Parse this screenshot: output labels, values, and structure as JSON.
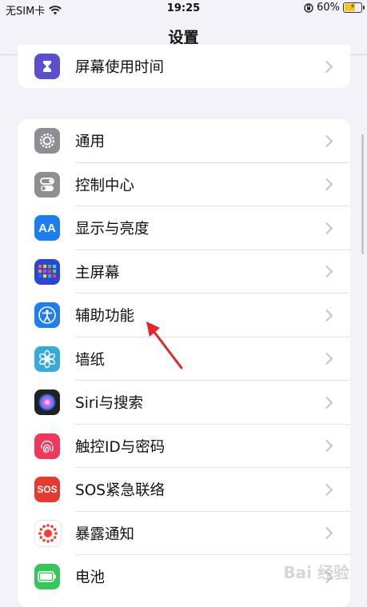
{
  "status": {
    "carrier": "无SIM卡",
    "time": "19:25",
    "battery": "60%",
    "battery_level": 0.6
  },
  "nav": {
    "title": "设置"
  },
  "group_top": [
    {
      "name": "screen-time",
      "label": "屏幕使用时间",
      "icon": "hourglass-icon",
      "color": "#5a4fcf"
    }
  ],
  "group_main": [
    {
      "name": "general",
      "label": "通用",
      "icon": "gear-icon",
      "color": "#8e8e93"
    },
    {
      "name": "control-center",
      "label": "控制中心",
      "icon": "toggles-icon",
      "color": "#8e8e93"
    },
    {
      "name": "display",
      "label": "显示与亮度",
      "icon": "aa-icon",
      "color": "#1c7cf2"
    },
    {
      "name": "home-screen",
      "label": "主屏幕",
      "icon": "grid-icon",
      "color": "#2b45d8"
    },
    {
      "name": "accessibility",
      "label": "辅助功能",
      "icon": "accessibility-icon",
      "color": "#1e7ef0"
    },
    {
      "name": "wallpaper",
      "label": "墙纸",
      "icon": "flower-icon",
      "color": "#35aadc"
    },
    {
      "name": "siri",
      "label": "Siri与搜索",
      "icon": "siri-icon",
      "color": "#222"
    },
    {
      "name": "touch-id",
      "label": "触控ID与密码",
      "icon": "fingerprint-icon",
      "color": "#f0365a"
    },
    {
      "name": "sos",
      "label": "SOS紧急联络",
      "icon": "sos-icon",
      "color": "#e63a30",
      "icon_text": "SOS"
    },
    {
      "name": "exposure",
      "label": "暴露通知",
      "icon": "exposure-icon",
      "color": "#fff"
    },
    {
      "name": "battery",
      "label": "电池",
      "icon": "battery-icon",
      "color": "#34c759"
    }
  ],
  "watermark": "Bai 经验"
}
